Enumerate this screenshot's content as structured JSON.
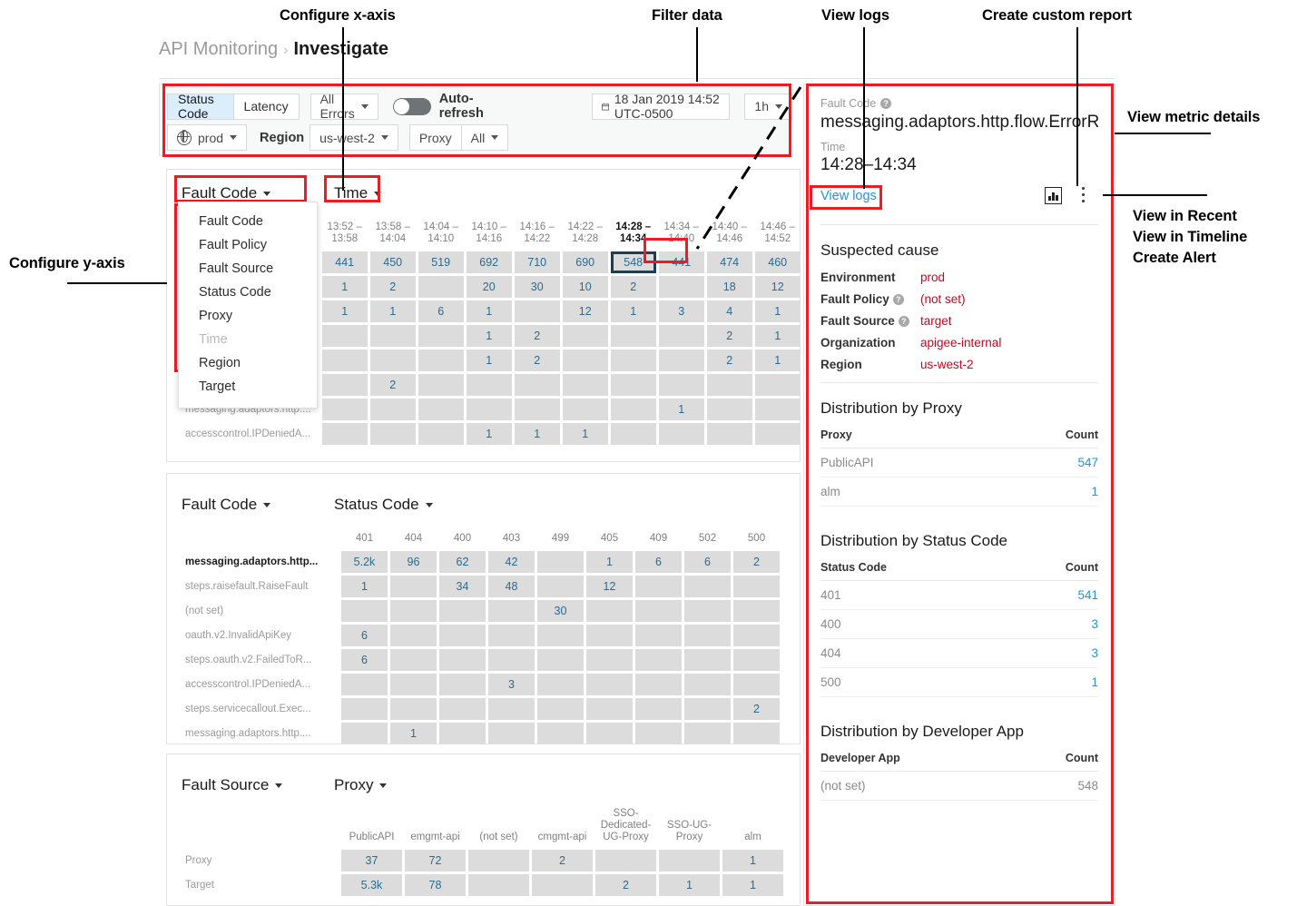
{
  "annotations": [
    {
      "id": "configure-x-axis",
      "text": "Configure x-axis"
    },
    {
      "id": "filter-data",
      "text": "Filter data"
    },
    {
      "id": "view-logs",
      "text": "View logs"
    },
    {
      "id": "create-custom-report",
      "text": "Create custom report"
    },
    {
      "id": "view-metric-details",
      "text": "View metric details"
    },
    {
      "id": "view-in-recent",
      "text": "View in Recent"
    },
    {
      "id": "view-in-timeline",
      "text": "View in Timeline"
    },
    {
      "id": "create-alert",
      "text": "Create Alert"
    },
    {
      "id": "configure-y-axis",
      "text": "Configure y-axis"
    }
  ],
  "breadcrumb": {
    "root": "API Monitoring",
    "separator": "›",
    "current": "Investigate"
  },
  "filterbar": {
    "metric_status_code": "Status Code",
    "metric_latency": "Latency",
    "errors_filter": "All Errors",
    "autorefresh_label": "Auto-refresh",
    "date_value": "18 Jan 2019 14:52 UTC-0500",
    "calendar_icon": "calendar-icon",
    "duration": "1h",
    "env": "prod",
    "region_label": "Region",
    "region_value": "us-west-2",
    "proxy_label": "Proxy",
    "proxy_value": "All"
  },
  "ymenu": {
    "items": [
      {
        "label": "Fault Code",
        "disabled": false
      },
      {
        "label": "Fault Policy",
        "disabled": false
      },
      {
        "label": "Fault Source",
        "disabled": false
      },
      {
        "label": "Status Code",
        "disabled": false
      },
      {
        "label": "Proxy",
        "disabled": false
      },
      {
        "label": "Time",
        "disabled": true
      },
      {
        "label": "Region",
        "disabled": false
      },
      {
        "label": "Target",
        "disabled": false
      }
    ]
  },
  "chart_data": [
    {
      "type": "heatmap",
      "title": "",
      "ylabel": "Fault Code",
      "xlabel": "Time",
      "categories": [
        "13:52 –\n13:58",
        "13:58 –\n14:04",
        "14:04 –\n14:10",
        "14:10 –\n14:16",
        "14:16 –\n14:22",
        "14:22 –\n14:28",
        "14:28 –\n14:34",
        "14:34 –\n14:40",
        "14:40 –\n14:46",
        "14:46 –\n14:52"
      ],
      "selected_column_index": 6,
      "selected_cell": {
        "row": 0,
        "col": 6,
        "value": "548"
      },
      "rows": [
        {
          "label": "",
          "values": [
            "441",
            "450",
            "519",
            "692",
            "710",
            "690",
            "548",
            "441",
            "474",
            "460"
          ]
        },
        {
          "label": "",
          "values": [
            "1",
            "2",
            "",
            "20",
            "30",
            "10",
            "2",
            "",
            "18",
            "12"
          ]
        },
        {
          "label": "",
          "values": [
            "1",
            "1",
            "6",
            "1",
            "",
            "12",
            "1",
            "3",
            "4",
            "1"
          ]
        },
        {
          "label": "",
          "values": [
            "",
            "",
            "",
            "1",
            "2",
            "",
            "",
            "",
            "2",
            "1"
          ]
        },
        {
          "label": "",
          "values": [
            "",
            "",
            "",
            "1",
            "2",
            "",
            "",
            "",
            "2",
            "1"
          ]
        },
        {
          "label": "",
          "values": [
            "",
            "2",
            "",
            "",
            "",
            "",
            "",
            "",
            "",
            ""
          ]
        },
        {
          "label": "messaging.adaptors.http....",
          "values": [
            "",
            "",
            "",
            "",
            "",
            "",
            "",
            "1",
            "",
            ""
          ]
        },
        {
          "label": "accesscontrol.IPDeniedA...",
          "values": [
            "",
            "",
            "",
            "1",
            "1",
            "1",
            "",
            "",
            "",
            ""
          ]
        }
      ]
    },
    {
      "type": "heatmap",
      "ylabel": "Fault Code",
      "xlabel": "Status Code",
      "categories": [
        "401",
        "404",
        "400",
        "403",
        "499",
        "405",
        "409",
        "502",
        "500"
      ],
      "rows": [
        {
          "label": "messaging.adaptors.http...",
          "bold": true,
          "values": [
            "5.2k",
            "96",
            "62",
            "42",
            "",
            "1",
            "6",
            "6",
            "2"
          ]
        },
        {
          "label": "steps.raisefault.RaiseFault",
          "values": [
            "1",
            "",
            "34",
            "48",
            "",
            "12",
            "",
            "",
            ""
          ]
        },
        {
          "label": "(not set)",
          "values": [
            "",
            "",
            "",
            "",
            "30",
            "",
            "",
            "",
            ""
          ]
        },
        {
          "label": "oauth.v2.InvalidApiKey",
          "values": [
            "6",
            "",
            "",
            "",
            "",
            "",
            "",
            "",
            ""
          ]
        },
        {
          "label": "steps.oauth.v2.FailedToR...",
          "values": [
            "6",
            "",
            "",
            "",
            "",
            "",
            "",
            "",
            ""
          ]
        },
        {
          "label": "accesscontrol.IPDeniedA...",
          "values": [
            "",
            "",
            "",
            "3",
            "",
            "",
            "",
            "",
            ""
          ]
        },
        {
          "label": "steps.servicecallout.Exec...",
          "values": [
            "",
            "",
            "",
            "",
            "",
            "",
            "",
            "",
            "2"
          ]
        },
        {
          "label": "messaging.adaptors.http....",
          "values": [
            "",
            "1",
            "",
            "",
            "",
            "",
            "",
            "",
            ""
          ]
        }
      ]
    },
    {
      "type": "heatmap",
      "ylabel": "Fault Source",
      "xlabel": "Proxy",
      "categories": [
        "PublicAPI",
        "emgmt-api",
        "(not set)",
        "cmgmt-api",
        "SSO-\nDedicated-\nUG-Proxy",
        "SSO-UG-\nProxy",
        "alm"
      ],
      "rows": [
        {
          "label": "Proxy",
          "values": [
            "37",
            "72",
            "",
            "2",
            "",
            "",
            "1"
          ]
        },
        {
          "label": "Target",
          "values": [
            "5.3k",
            "78",
            "",
            "",
            "2",
            "1",
            "1"
          ]
        }
      ]
    }
  ],
  "detail": {
    "fault_code_label": "Fault Code",
    "fault_code_value": "messaging.adaptors.http.flow.ErrorRe...",
    "time_label": "Time",
    "time_value": "14:28–14:34",
    "view_logs": "View logs",
    "chart_icon": "bar-chart-icon",
    "kebab_icon": "kebab-menu-icon",
    "suspected_cause_title": "Suspected cause",
    "suspected_cause": [
      {
        "key": "Environment",
        "value": "prod",
        "help": false
      },
      {
        "key": "Fault Policy",
        "value": "(not set)",
        "help": true
      },
      {
        "key": "Fault Source",
        "value": "target",
        "help": true
      },
      {
        "key": "Organization",
        "value": "apigee-internal",
        "help": false
      },
      {
        "key": "Region",
        "value": "us-west-2",
        "help": false
      }
    ],
    "dist_proxy": {
      "title": "Distribution by Proxy",
      "col1": "Proxy",
      "col2": "Count",
      "rows": [
        {
          "name": "PublicAPI",
          "count": "547"
        },
        {
          "name": "alm",
          "count": "1"
        }
      ]
    },
    "dist_status": {
      "title": "Distribution by Status Code",
      "col1": "Status Code",
      "col2": "Count",
      "rows": [
        {
          "name": "401",
          "count": "541"
        },
        {
          "name": "400",
          "count": "3"
        },
        {
          "name": "404",
          "count": "3"
        },
        {
          "name": "500",
          "count": "1"
        }
      ]
    },
    "dist_devapp": {
      "title": "Distribution by Developer App",
      "col1": "Developer App",
      "col2": "Count",
      "rows": [
        {
          "name": "(not set)",
          "count": "548",
          "plain": true
        }
      ]
    }
  },
  "colors": {
    "accent_red": "#ed1c24",
    "link_blue": "#2196d6",
    "value_red": "#d0021b",
    "heat_max": "#0b9dd9",
    "heat_empty": "#dcdcdc"
  }
}
